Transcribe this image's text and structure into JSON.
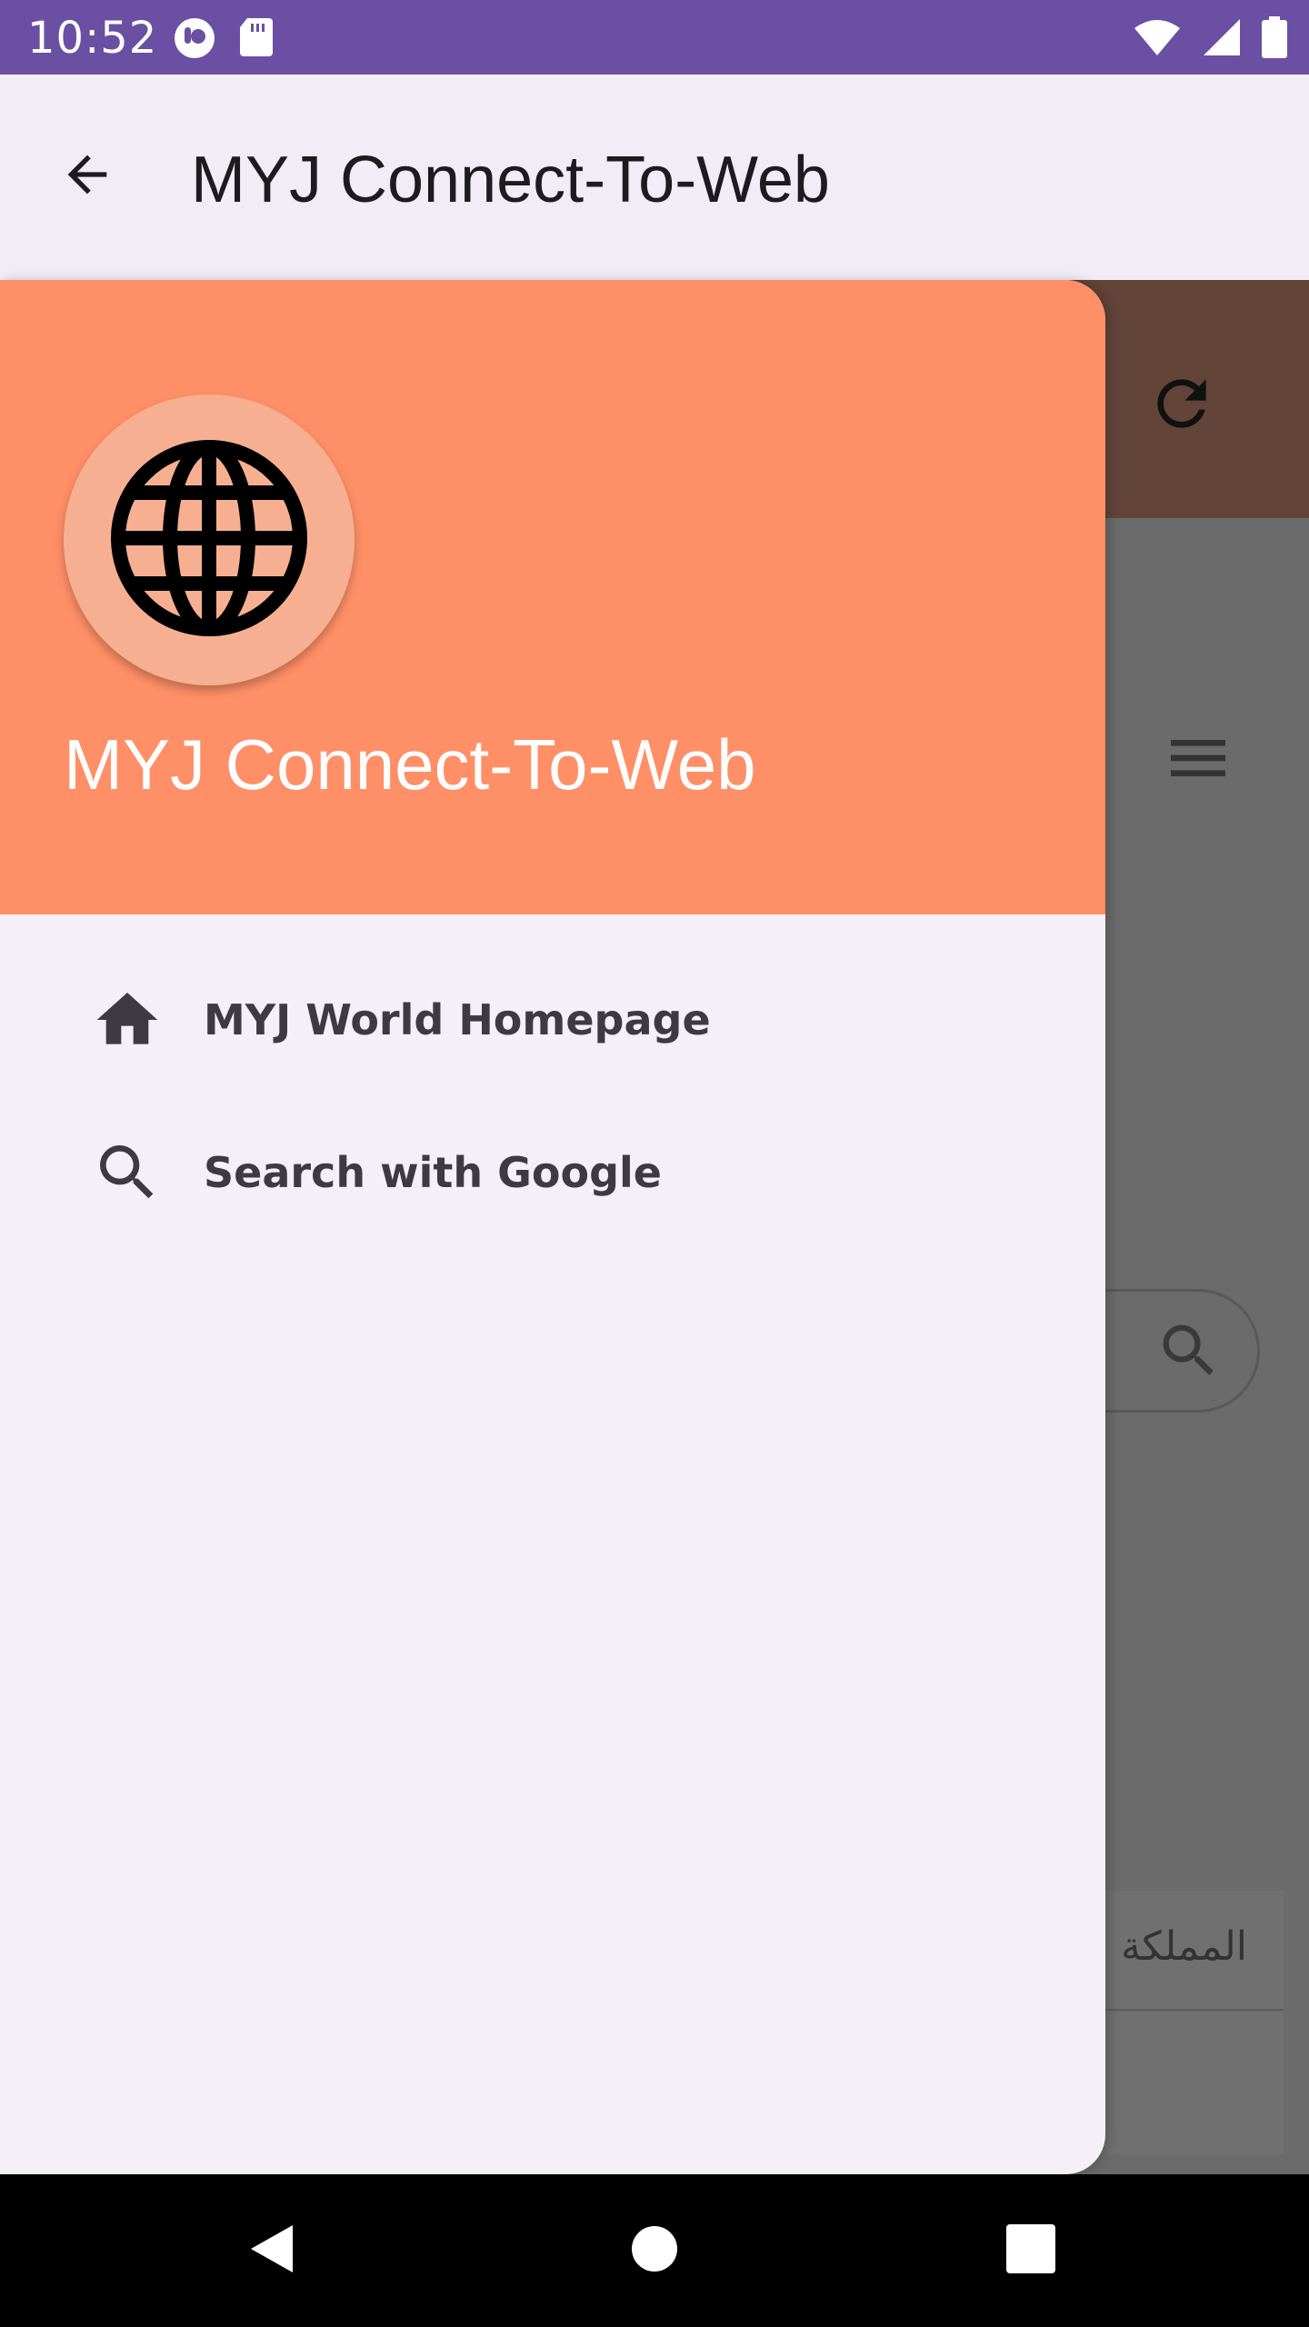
{
  "status_bar": {
    "time": "10:52",
    "left_icons": [
      "notification-icon",
      "sd-card-icon"
    ],
    "right_icons": [
      "wifi-icon",
      "signal-icon",
      "battery-icon"
    ],
    "background": "#6a4fa3"
  },
  "app_bar": {
    "title": "MYJ Connect-To-Web",
    "back_icon": "arrow-back-icon"
  },
  "drawer": {
    "header_color": "#ff8f66",
    "logo_icon": "globe-icon",
    "title": "MYJ Connect-To-Web",
    "items": [
      {
        "label": "MYJ World Homepage",
        "icon": "home-icon"
      },
      {
        "label": "Search with Google",
        "icon": "search-icon"
      }
    ]
  },
  "web_content": {
    "header_color": "#624439",
    "refresh_icon": "refresh-icon",
    "menu_icon": "hamburger-menu-icon",
    "search_icon": "search-icon",
    "arabic_text": "المملكة ا"
  },
  "nav_bar": {
    "buttons": [
      "back-triangle-icon",
      "home-circle-icon",
      "recents-square-icon"
    ]
  }
}
